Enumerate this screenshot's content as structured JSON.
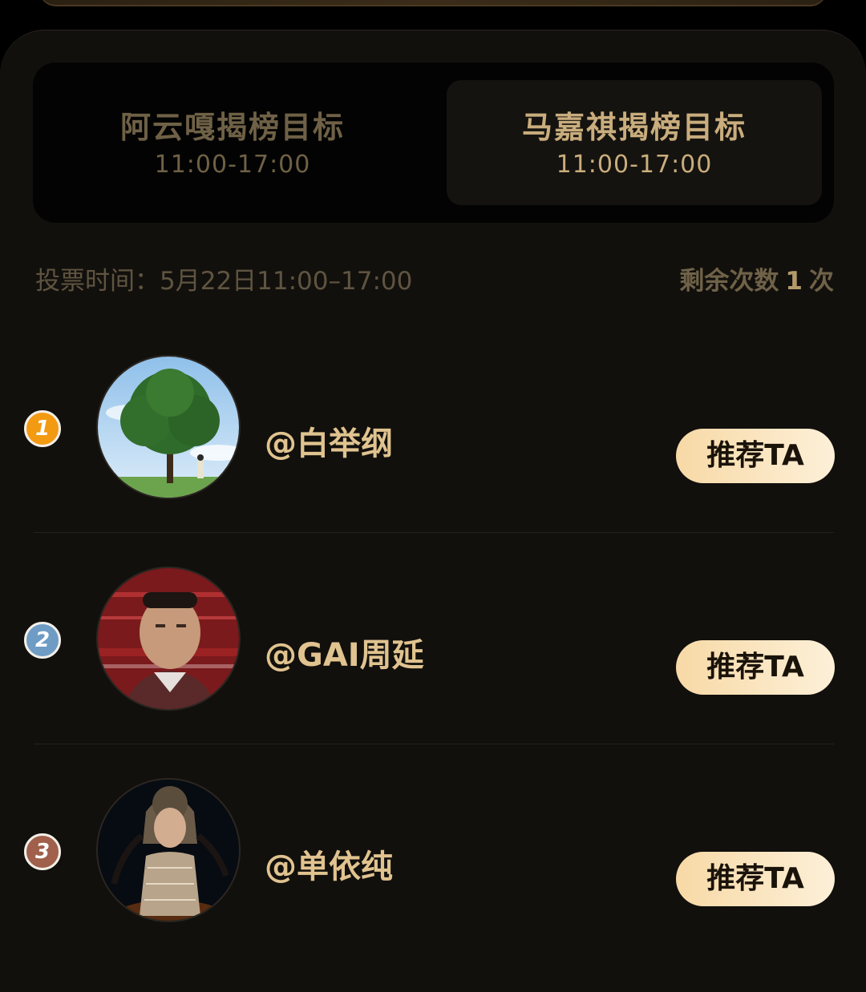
{
  "tabs": [
    {
      "title": "阿云嘎揭榜目标",
      "time": "11:00-17:00",
      "active": false
    },
    {
      "title": "马嘉祺揭榜目标",
      "time": "11:00-17:00",
      "active": true
    }
  ],
  "vote_time": "投票时间：5月22日11:00–17:00",
  "remaining": {
    "prefix": "剩余次数",
    "count": "1",
    "suffix": "次"
  },
  "candidates": [
    {
      "rank": "1",
      "name": "@白举纲",
      "button": "推荐TA",
      "badge_color": "#f39a13",
      "avatar": "tree-avatar"
    },
    {
      "rank": "2",
      "name": "@GAI周延",
      "button": "推荐TA",
      "badge_color": "#6e9cc5",
      "avatar": "man-avatar"
    },
    {
      "rank": "3",
      "name": "@单依纯",
      "button": "推荐TA",
      "badge_color": "#a0604c",
      "avatar": "woman-avatar"
    }
  ],
  "colors": {
    "background": "#12100d",
    "accent_gold": "#e0c38f",
    "button_gradient_start": "#f7d9a6",
    "button_gradient_end": "#fdf0d8"
  }
}
